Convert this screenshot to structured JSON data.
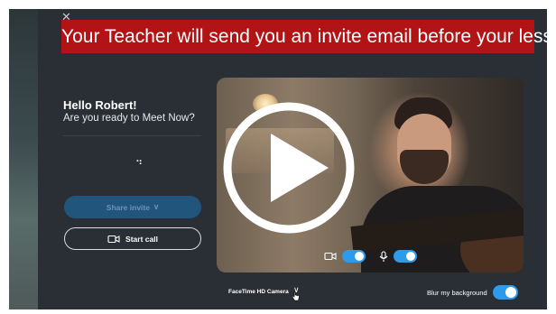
{
  "banner": {
    "text": "Your Teacher will send you an invite email before your lesson",
    "color": "#b21416"
  },
  "greeting": {
    "title": "Hello Robert!",
    "subtitle": "Are you ready to Meet Now?"
  },
  "actions": {
    "share_invite_label": "Share invite",
    "share_invite_chevron": "∨",
    "start_call_label": "Start call"
  },
  "preview": {
    "camera_enabled": true,
    "mic_enabled": true,
    "camera_name": "FaceTime HD Camera",
    "camera_chevron": "∨",
    "blur_label": "Blur my background",
    "blur_enabled": true
  },
  "icons": {
    "close": "close-icon",
    "play": "play-icon",
    "camera": "video-camera-icon",
    "microphone": "microphone-icon",
    "start_call": "video-camera-icon",
    "cursor": "hand-cursor-icon"
  },
  "colors": {
    "accent": "#2e9bea",
    "share_button": "#22557c",
    "panel": "#2a2e35"
  }
}
